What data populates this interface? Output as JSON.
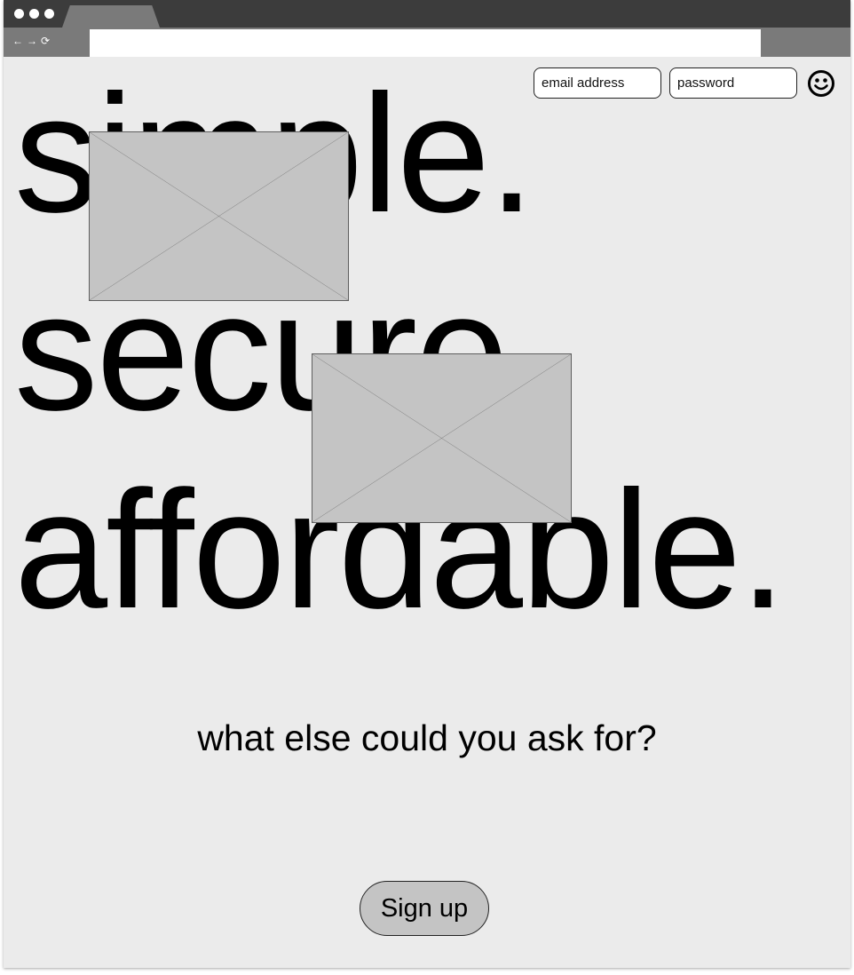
{
  "browser": {
    "nav": {
      "back_glyph": "←",
      "forward_glyph": "→",
      "reload_glyph": "⟳"
    },
    "address": ""
  },
  "header": {
    "email_placeholder": "email address",
    "password_placeholder": "password",
    "avatar_icon": "smiley-face-icon"
  },
  "hero": {
    "line1": "simple.",
    "line2": "secure.",
    "line3": "affordable."
  },
  "tagline": "what else could you ask for?",
  "cta": {
    "signup_label": "Sign up"
  },
  "colors": {
    "page_background": "#ebebeb",
    "placeholder_fill": "#c4c4c4",
    "chrome_dark": "#3c3c3c",
    "chrome_mid": "#7a7a7a"
  }
}
